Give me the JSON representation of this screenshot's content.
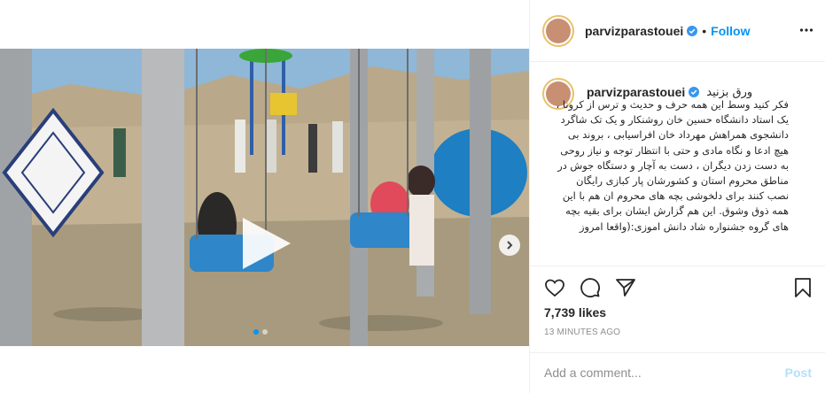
{
  "post": {
    "username": "parvizparastouei",
    "separator": "•",
    "follow_label": "Follow",
    "caption_first_line": "ورق بزنید",
    "caption_body": "فکر کنید وسط این همه حرف و حدیث و ترس از کرونا ، یک استاد دانشگاه حسین خان روشنکار و یک تک شاگرد دانشجوی همراهش مهرداد خان افراسیابی ، بروند بی هیچ ادعا و نگاه مادی و حتی با انتظار توجه و نیاز روحی به دست زدن دیگران ، دست به آچار و دستگاه جوش در مناطق محروم استان و کشورشان پار کبازی رایگان نصب کنند برای دلخوشی بچه های محروم ان هم با این همه ذوق وشوق. این هم گزارش ایشان برای بقیه بچه های گروه جشنواره شاد دانش اموزی:(واقعا امروز",
    "likes": "7,739 likes",
    "time_ago": "13 MINUTES AGO",
    "comment_placeholder": "Add a comment...",
    "post_label": "Post"
  },
  "media": {
    "type": "video",
    "carousel_dots": 2,
    "active_dot": 0
  },
  "icons": {
    "verified": "verified-badge-icon",
    "more": "more-options-icon",
    "like": "heart-icon",
    "comment": "comment-icon",
    "share": "share-icon",
    "save": "bookmark-icon",
    "play": "play-icon",
    "next": "chevron-right-icon"
  },
  "colors": {
    "accent": "#0095f6",
    "post_disabled": "#b2dffc",
    "muted": "#8e8e8e"
  }
}
